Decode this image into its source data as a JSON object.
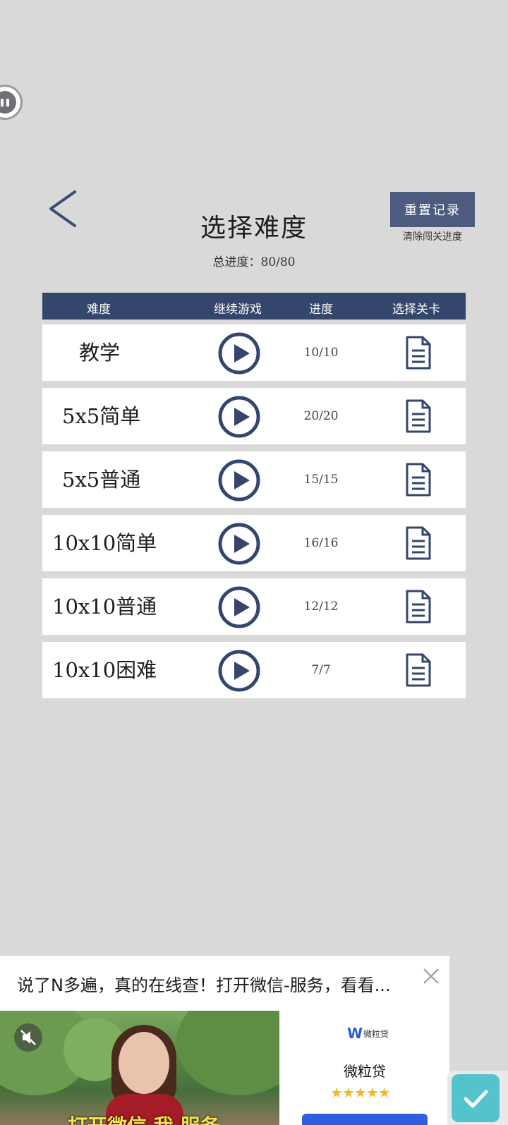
{
  "header": {
    "title": "选择难度",
    "total_label": "总进度：",
    "total_value": "80/80",
    "reset_label": "重置记录",
    "reset_sub": "清除闯关进度"
  },
  "table": {
    "headers": [
      "难度",
      "继续游戏",
      "进度",
      "选择关卡"
    ],
    "rows": [
      {
        "name": "教学",
        "progress": "10/10"
      },
      {
        "name": "5x5简单",
        "progress": "20/20"
      },
      {
        "name": "5x5普通",
        "progress": "15/15"
      },
      {
        "name": "10x10简单",
        "progress": "16/16"
      },
      {
        "name": "10x10普通",
        "progress": "12/12"
      },
      {
        "name": "10x10困难",
        "progress": "7/7"
      }
    ]
  },
  "ad": {
    "title": "说了N多遍，真的在线查！打开微信-服务，看看...",
    "caption": "打开微信 我 服务",
    "logo_letter": "W",
    "logo_text": "微粒贷",
    "brand": "微粒贷",
    "stars": "★★★★★"
  },
  "colors": {
    "background": "#d9d9d9",
    "accent": "#34466b",
    "button": "#4d5b7e",
    "confirm": "#55c3cc"
  },
  "icons": [
    "pause-icon",
    "back-arrow-icon",
    "play-icon",
    "document-icon",
    "close-icon",
    "mute-icon",
    "check-icon"
  ]
}
